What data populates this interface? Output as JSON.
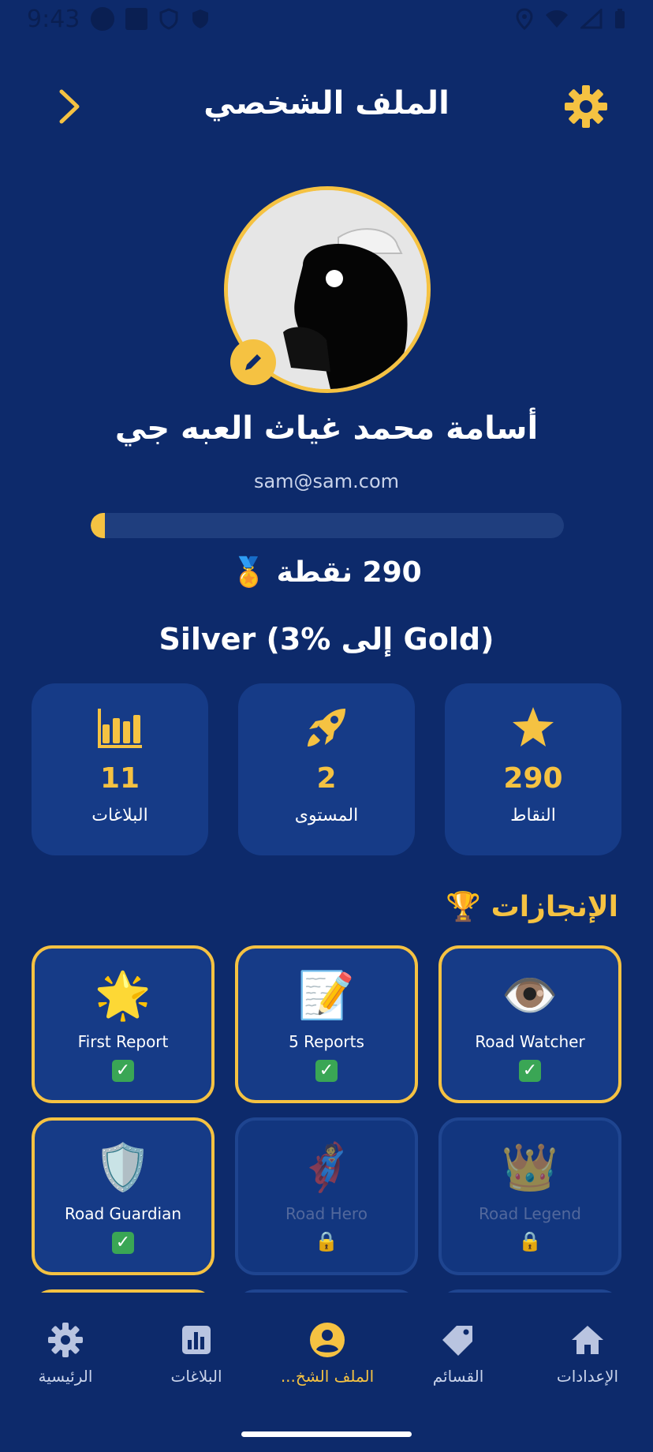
{
  "status_bar": {
    "time": "9:43"
  },
  "header": {
    "title": "الملف الشخصي",
    "back_icon": "chevron-right-icon",
    "settings_icon": "gear-icon"
  },
  "profile": {
    "name": "أسامة محمد غياث العبه جي",
    "email": "sam@sam.com",
    "progress_percent": 3,
    "points_text": "290 نقطة 🏅",
    "rank_text": "Silver (3% إلى Gold)"
  },
  "stats": [
    {
      "icon": "bar-chart-icon",
      "value": "11",
      "label": "البلاغات"
    },
    {
      "icon": "rocket-icon",
      "value": "2",
      "label": "المستوى"
    },
    {
      "icon": "star-icon",
      "value": "290",
      "label": "النقاط"
    }
  ],
  "achievements": {
    "title": "الإنجازات 🏆",
    "items": [
      {
        "emoji": "🌟",
        "label": "First Report",
        "status": "✅",
        "locked": false
      },
      {
        "emoji": "📝",
        "label": "5 Reports",
        "status": "✅",
        "locked": false
      },
      {
        "emoji": "👁️",
        "label": "Road Watcher",
        "status": "✅",
        "locked": false
      },
      {
        "emoji": "🛡️",
        "label": "Road Guardian",
        "status": "✅",
        "locked": false
      },
      {
        "emoji": "🦸",
        "label": "Road Hero",
        "status": "🔒",
        "locked": true
      },
      {
        "emoji": "👑",
        "label": "Road Legend",
        "status": "🔒",
        "locked": true
      }
    ]
  },
  "bottom_nav": [
    {
      "icon": "home-icon",
      "label": "الرئيسية",
      "active": false
    },
    {
      "icon": "bar-chart-icon",
      "label": "البلاغات",
      "active": false
    },
    {
      "icon": "account-circle-icon",
      "label": "الملف الشخ...",
      "active": true
    },
    {
      "icon": "tag-icon",
      "label": "القسائم",
      "active": false
    },
    {
      "icon": "gear-icon",
      "label": "الإعدادات",
      "active": false
    }
  ],
  "colors": {
    "background": "#0d2a6b",
    "card": "#163b87",
    "accent": "#f5c242"
  }
}
